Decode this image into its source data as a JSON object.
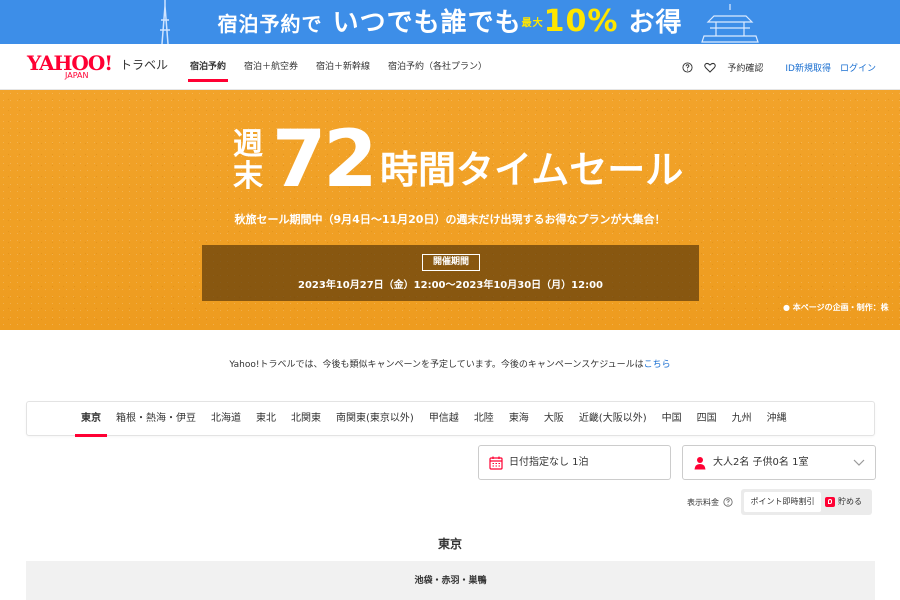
{
  "promo": {
    "text_a": "宿泊予約で",
    "text_b": "いつでも誰でも",
    "text_pct": "10%",
    "text_max": "最大",
    "text_c": "お得",
    "color": "#3d8ee8"
  },
  "header": {
    "logo_yahoo": "YAHOO!",
    "logo_japan": "JAPAN",
    "logo_travel": "トラベル",
    "nav": [
      {
        "label": "宿泊予約",
        "active": true
      },
      {
        "label": "宿泊＋航空券"
      },
      {
        "label": "宿泊＋新幹線"
      },
      {
        "label": "宿泊予約（各社プラン）"
      }
    ],
    "icons": [
      "help-icon",
      "heart-icon"
    ],
    "reservation_check": "予約確認",
    "register": "ID新規取得",
    "login": "ログイン"
  },
  "hero": {
    "title_vertical": "週末",
    "title_number": "72",
    "title_main": "時間タイムセール",
    "subtitle": "秋旅セール期間中（9月4日〜11月20日）の週末だけ出現するお得なプランが大集合！",
    "period_label": "開催期間",
    "period": "2023年10月27日（金）12:00〜2023年10月30日（月）12:00",
    "note": "● 本ページの企画・制作：株"
  },
  "notice": {
    "text": "Yahoo!トラベルでは、今後も類似キャンペーンを予定しています。今後のキャンペーンスケジュールは",
    "link": "こちら"
  },
  "regions": [
    "東京",
    "箱根・熱海・伊豆",
    "北海道",
    "東北",
    "北関東",
    "南関東(東京以外)",
    "甲信越",
    "北陸",
    "東海",
    "大阪",
    "近畿(大阪以外)",
    "中国",
    "四国",
    "九州",
    "沖縄"
  ],
  "search": {
    "date_value": "日付指定なし 1泊",
    "guest_value": "大人2名  子供0名  1室"
  },
  "price": {
    "label": "表示料金",
    "option_on": "ポイント即時割引",
    "option_off": "貯める"
  },
  "section": {
    "title": "東京",
    "area": "池袋・赤羽・巣鴨"
  },
  "colors": {
    "accent": "#ff0033",
    "hero": "#f0a025",
    "link": "#1a6fd1"
  }
}
